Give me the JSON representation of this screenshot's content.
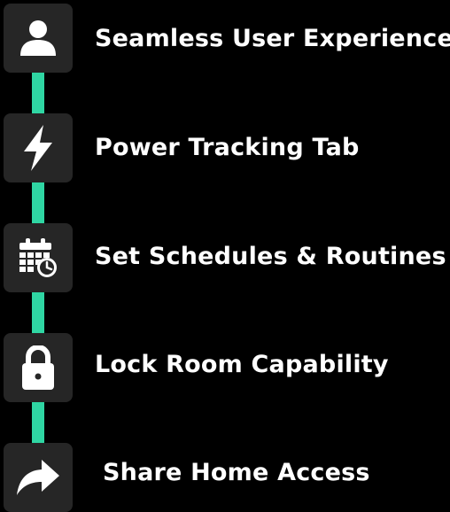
{
  "features": [
    {
      "label": "Seamless User Experience",
      "icon": "user-icon"
    },
    {
      "label": "Power Tracking Tab",
      "icon": "lightning-bolt-icon"
    },
    {
      "label": "Set Schedules & Routines",
      "icon": "calendar-clock-icon"
    },
    {
      "label": "Lock Room Capability",
      "icon": "lock-icon"
    },
    {
      "label": "Share Home Access",
      "icon": "share-arrow-icon"
    }
  ],
  "colors": {
    "background": "#000000",
    "connector": "#2fd6a3",
    "tile": "#262626",
    "icon": "#ffffff",
    "text": "#ffffff"
  }
}
